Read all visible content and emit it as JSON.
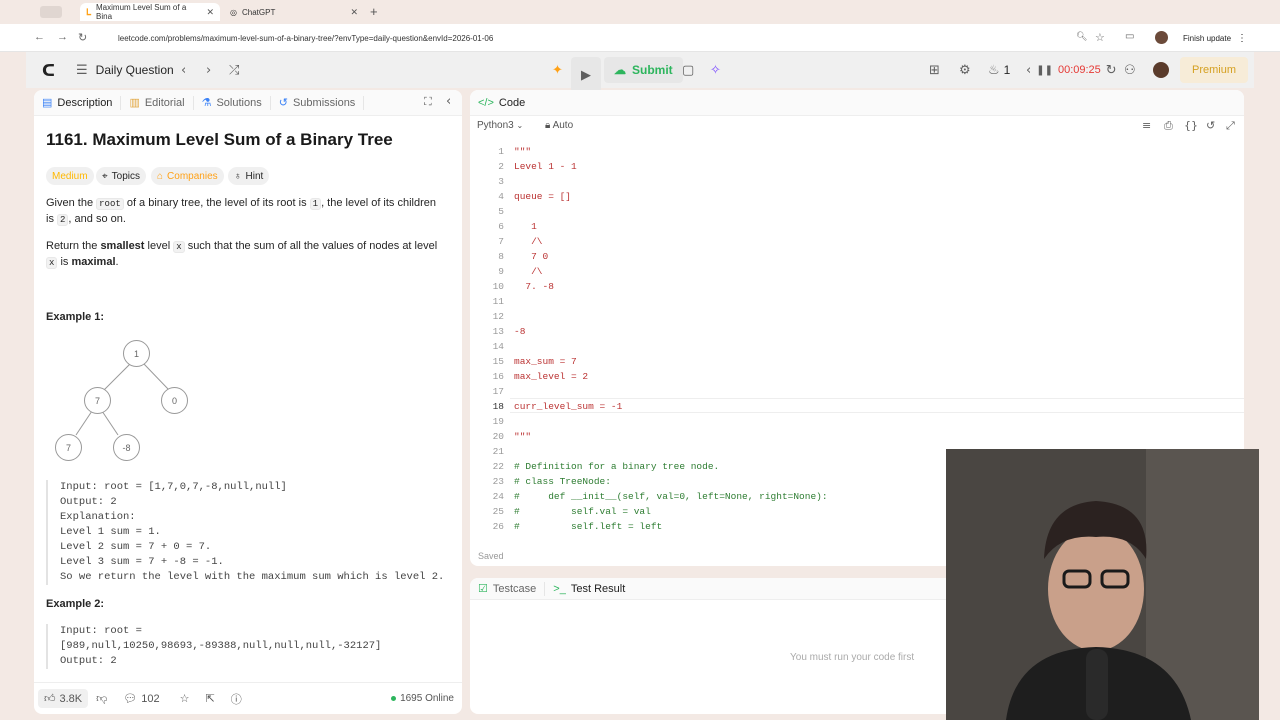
{
  "browser": {
    "tabs": [
      {
        "label": "Maximum Level Sum of a Bina",
        "active": true
      },
      {
        "label": "ChatGPT",
        "active": false
      }
    ],
    "url": "leetcode.com/problems/maximum-level-sum-of-a-binary-tree/?envType=daily-question&envId=2026-01-06",
    "finish_update": "Finish update"
  },
  "topbar": {
    "daily_question": "Daily Question",
    "submit": "Submit",
    "streak": "1",
    "timer": "00:09:25",
    "premium": "Premium"
  },
  "left_panel": {
    "tabs": [
      "Description",
      "Editorial",
      "Solutions",
      "Submissions"
    ],
    "title": "1161. Maximum Level Sum of a Binary Tree",
    "difficulty": "Medium",
    "pills": [
      "Topics",
      "Companies",
      "Hint"
    ],
    "para1": {
      "a": "Given the",
      "root": "root",
      "b": "of a binary tree, the level of its root is",
      "one": "1",
      "c": ", the level of its children is",
      "two": "2",
      "d": ", and so on."
    },
    "para2": {
      "a": "Return the",
      "smallest": "smallest",
      "b": "level",
      "x": "x",
      "c": "such that the sum of all the values of nodes at level",
      "x2": "x",
      "d": "is",
      "maximal": "maximal",
      "e": "."
    },
    "example1_title": "Example 1:",
    "tree_nodes": [
      "1",
      "7",
      "0",
      "7",
      "-8"
    ],
    "example1_lines": [
      "Input: root = [1,7,0,7,-8,null,null]",
      "Output: 2",
      "Explanation:",
      "Level 1 sum = 1.",
      "Level 2 sum = 7 + 0 = 7.",
      "Level 3 sum = 7 + -8 = -1.",
      "So we return the level with the maximum sum which is level 2."
    ],
    "example2_title": "Example 2:",
    "example2_lines": [
      "Input: root =",
      "[989,null,10250,98693,-89388,null,null,null,-32127]",
      "Output: 2"
    ],
    "likes": "3.8K",
    "comments": "102",
    "online": "1695 Online"
  },
  "code_panel": {
    "tab": "Code",
    "language": "Python3",
    "auto": "Auto",
    "saved": "Saved",
    "lines": [
      {
        "n": "1",
        "t": "\"\"\""
      },
      {
        "n": "2",
        "t": "Level 1 - 1"
      },
      {
        "n": "3",
        "t": ""
      },
      {
        "n": "4",
        "t": "queue = []"
      },
      {
        "n": "5",
        "t": ""
      },
      {
        "n": "6",
        "t": "   1"
      },
      {
        "n": "7",
        "t": "   /\\"
      },
      {
        "n": "8",
        "t": "   7 0"
      },
      {
        "n": "9",
        "t": "   /\\"
      },
      {
        "n": "10",
        "t": "  7. -8"
      },
      {
        "n": "11",
        "t": ""
      },
      {
        "n": "12",
        "t": ""
      },
      {
        "n": "13",
        "t": "-8"
      },
      {
        "n": "14",
        "t": ""
      },
      {
        "n": "15",
        "t": "max_sum = 7"
      },
      {
        "n": "16",
        "t": "max_level = 2"
      },
      {
        "n": "17",
        "t": ""
      },
      {
        "n": "18",
        "t": "curr_level_sum = -1"
      },
      {
        "n": "19",
        "t": ""
      },
      {
        "n": "20",
        "t": "\"\"\""
      },
      {
        "n": "21",
        "t": ""
      },
      {
        "n": "22",
        "t": "# Definition for a binary tree node."
      },
      {
        "n": "23",
        "t": "# class TreeNode:"
      },
      {
        "n": "24",
        "t": "#     def __init__(self, val=0, left=None, right=None):"
      },
      {
        "n": "25",
        "t": "#         self.val = val"
      },
      {
        "n": "26",
        "t": "#         self.left = left"
      }
    ]
  },
  "test_panel": {
    "tabs": [
      "Testcase",
      "Test Result"
    ],
    "empty_msg": "You must run your code first"
  },
  "colors": {
    "accent": "#ffa116",
    "green": "#2db55d",
    "red": "#e53935"
  }
}
